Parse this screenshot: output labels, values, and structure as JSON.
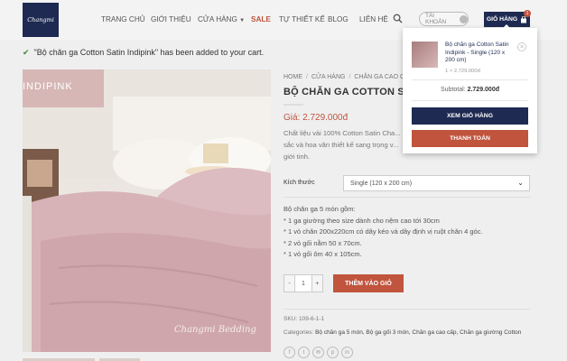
{
  "header": {
    "logo_text": "Changmi",
    "nav": [
      {
        "label": "TRANG CHỦ"
      },
      {
        "label": "GIỚI THIỆU"
      },
      {
        "label": "CỬA HÀNG"
      },
      {
        "label": "SALE"
      },
      {
        "label": "TỰ THIẾT KẾ"
      },
      {
        "label": "BLOG"
      },
      {
        "label": "LIÊN HỆ"
      }
    ],
    "account_label": "TÀI KHOẢN",
    "cart_label": "GIỎ HÀNG",
    "cart_count": "1",
    "search_icon": "search-icon",
    "accent_color": "#1f2a52",
    "sale_color": "#c0543d"
  },
  "notice": {
    "check": "✔",
    "message": "\"Bộ chăn ga Cotton Satin Indipink\" has been added to your cart."
  },
  "product_image": {
    "label": "INDIPINK",
    "signature": "Changmi Bedding"
  },
  "product": {
    "breadcrumb": [
      "HOME",
      "CỬA HÀNG",
      "CHĂN GA CAO CẤ..."
    ],
    "title": "BỘ CHĂN GA COTTON SATIN I...",
    "price": "Giá: 2.729.000đ",
    "description": "Chất liệu vải 100% Cotton Satin Cha... sắc và hoa văn thiết kế sang trọng v... giới tinh.",
    "option_label": "Kích thước",
    "option_value": "Single (120 x 200 cm)",
    "details": [
      "Bộ chăn ga 5 món gồm:",
      "* 1 ga giường theo size dành cho nệm cao tới 30cm",
      "* 1 vỏ chăn 200x220cm có dây kéo và dây định vị ruột chăn 4 góc.",
      "* 2 vỏ gối nằm 50 x 70cm.",
      "* 1 vỏ gối ôm 40 x 105cm."
    ],
    "qty_minus": "-",
    "qty_value": "1",
    "qty_plus": "+",
    "add_to_cart": "THÊM VÀO GIỎ",
    "sku": "SKU: 109-6-1-1",
    "categories_label": "Categories:",
    "categories": "Bộ chăn ga 5 món, Bộ ga gối 3 món, Chăn ga cao cấp, Chăn ga giường Cotton"
  },
  "minicart": {
    "item_name": "Bộ chăn ga Cotton Satin Indipink - Single (120 x 200 cm)",
    "item_qty": "1 × 2.729.000đ",
    "remove": "×",
    "subtotal_label": "Subtotal:",
    "subtotal_value": "2.729.000đ",
    "view_cart": "XEM GIỎ HÀNG",
    "checkout": "THANH TOÁN"
  }
}
